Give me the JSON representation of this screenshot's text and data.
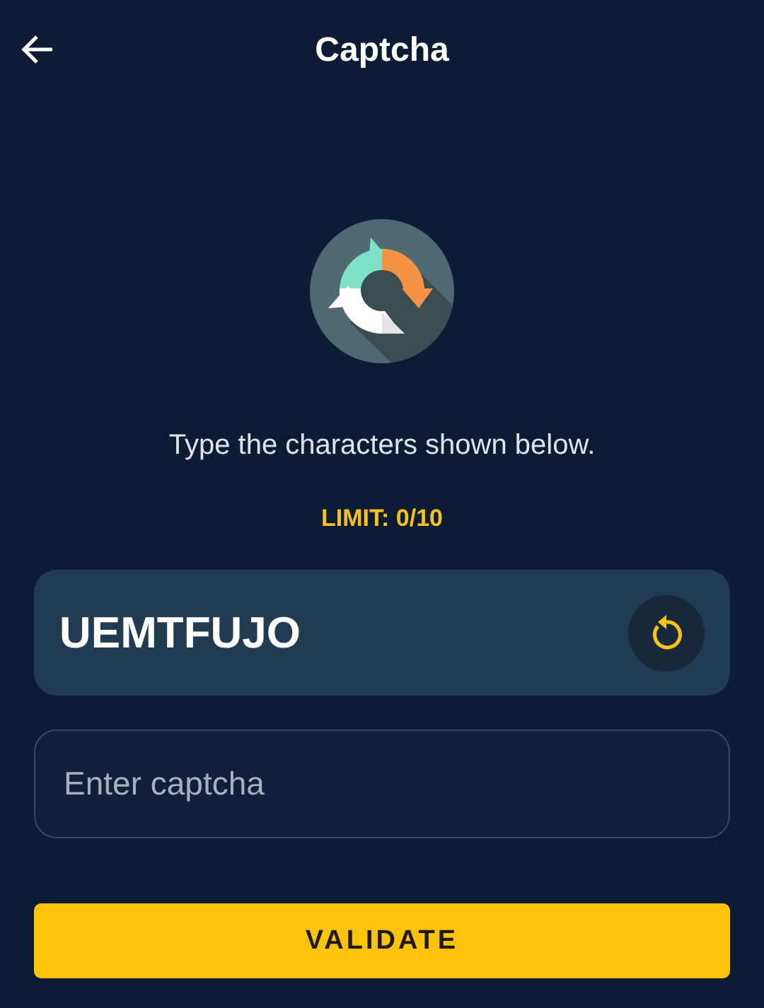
{
  "header": {
    "title": "Captcha"
  },
  "instruction": "Type the characters shown below.",
  "limit": "LIMIT: 0/10",
  "captcha": {
    "code": "UEMTFUJO"
  },
  "input": {
    "placeholder": "Enter captcha"
  },
  "button": {
    "label": "VALIDATE"
  }
}
